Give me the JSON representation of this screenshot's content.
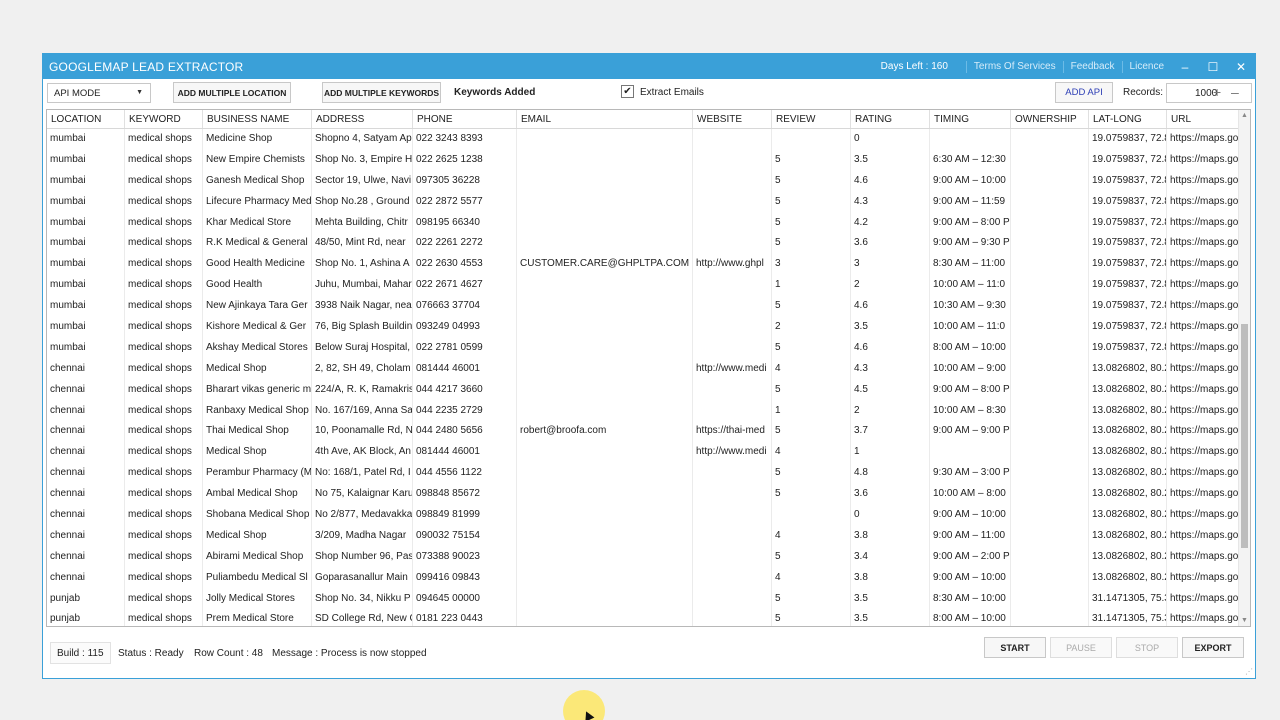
{
  "window": {
    "title": "GOOGLEMAP LEAD EXTRACTOR",
    "days_left": "Days Left : 160",
    "links": [
      "Terms Of Services",
      "Feedback",
      "Licence"
    ],
    "controls": {
      "minimize": "–",
      "maximize": "☐",
      "close": "✕"
    }
  },
  "toolbar": {
    "mode": "API MODE",
    "add_locations": "ADD MULTIPLE LOCATION",
    "add_keywords": "ADD MULTIPLE KEYWORDS",
    "keywords_added": "Keywords Added",
    "extract_emails_label": "Extract Emails",
    "extract_emails_checked": "✔",
    "add_api": "ADD API",
    "records_label": "Records:",
    "records_value": "1000",
    "plus": "+",
    "minus": "–"
  },
  "grid": {
    "columns": [
      "LOCATION",
      "KEYWORD",
      "BUSINESS NAME",
      "ADDRESS",
      "PHONE",
      "EMAIL",
      "WEBSITE",
      "REVIEW",
      "RATING",
      "TIMING",
      "OWNERSHIP",
      "LAT-LONG",
      "URL"
    ],
    "rows": [
      [
        "mumbai",
        "medical shops",
        "Medicine Shop",
        "Shopno 4, Satyam Ap",
        "022 3243 8393",
        "",
        "",
        "",
        "0",
        "",
        "",
        "19.0759837, 72.8",
        "https://maps.goo"
      ],
      [
        "mumbai",
        "medical shops",
        "New Empire Chemists",
        "Shop No. 3, Empire H",
        "022 2625 1238",
        "",
        "",
        "5",
        "3.5",
        "6:30 AM – 12:30",
        "",
        "19.0759837, 72.8",
        "https://maps.goo"
      ],
      [
        "mumbai",
        "medical shops",
        "Ganesh Medical Shop",
        "Sector 19, Ulwe, Navi",
        "097305 36228",
        "",
        "",
        "5",
        "4.6",
        "9:00 AM – 10:00",
        "",
        "19.0759837, 72.8",
        "https://maps.goo"
      ],
      [
        "mumbai",
        "medical shops",
        "Lifecure Pharmacy Med",
        "Shop No.28 , Ground",
        "022 2872 5577",
        "",
        "",
        "5",
        "4.3",
        "9:00 AM – 11:59",
        "",
        "19.0759837, 72.8",
        "https://maps.goo"
      ],
      [
        "mumbai",
        "medical shops",
        "Khar Medical Store",
        "Mehta Building, Chitr",
        "098195 66340",
        "",
        "",
        "5",
        "4.2",
        "9:00 AM – 8:00 P",
        "",
        "19.0759837, 72.8",
        "https://maps.goo"
      ],
      [
        "mumbai",
        "medical shops",
        "R.K Medical & General",
        "48/50, Mint Rd, near",
        "022 2261 2272",
        "",
        "",
        "5",
        "3.6",
        "9:00 AM – 9:30 P",
        "",
        "19.0759837, 72.8",
        "https://maps.goo"
      ],
      [
        "mumbai",
        "medical shops",
        "Good Health Medicine",
        "Shop No. 1, Ashina A",
        "022 2630 4553",
        "CUSTOMER.CARE@GHPLTPA.COM",
        "http://www.ghpl",
        "3",
        "3",
        "8:30 AM – 11:00",
        "",
        "19.0759837, 72.8",
        "https://maps.goo"
      ],
      [
        "mumbai",
        "medical shops",
        "Good Health",
        "Juhu, Mumbai, Mahar",
        "022 2671 4627",
        "",
        "",
        "1",
        "2",
        "10:00 AM – 11:0",
        "",
        "19.0759837, 72.8",
        "https://maps.goo"
      ],
      [
        "mumbai",
        "medical shops",
        "New Ajinkaya Tara Ger",
        "3938 Naik Nagar, nea",
        "076663 37704",
        "",
        "",
        "5",
        "4.6",
        "10:30 AM – 9:30",
        "",
        "19.0759837, 72.8",
        "https://maps.goo"
      ],
      [
        "mumbai",
        "medical shops",
        "Kishore Medical & Ger",
        "76, Big Splash Buildin",
        "093249 04993",
        "",
        "",
        "2",
        "3.5",
        "10:00 AM – 11:0",
        "",
        "19.0759837, 72.8",
        "https://maps.goo"
      ],
      [
        "mumbai",
        "medical shops",
        "Akshay Medical Stores",
        "Below Suraj Hospital,",
        "022 2781 0599",
        "",
        "",
        "5",
        "4.6",
        "8:00 AM – 10:00",
        "",
        "19.0759837, 72.8",
        "https://maps.goo"
      ],
      [
        "chennai",
        "medical shops",
        "Medical Shop",
        "2, 82, SH 49, Cholam",
        "081444 46001",
        "",
        "http://www.medi",
        "4",
        "4.3",
        "10:00 AM – 9:00",
        "",
        "13.0826802, 80.2",
        "https://maps.goo"
      ],
      [
        "chennai",
        "medical shops",
        "Bharart vikas generic m",
        "224/A, R. K, Ramakris",
        "044 4217 3660",
        "",
        "",
        "5",
        "4.5",
        "9:00 AM – 8:00 P",
        "",
        "13.0826802, 80.2",
        "https://maps.goo"
      ],
      [
        "chennai",
        "medical shops",
        "Ranbaxy Medical Shop",
        "No. 167/169, Anna Sa",
        "044 2235 2729",
        "",
        "",
        "1",
        "2",
        "10:00 AM – 8:30",
        "",
        "13.0826802, 80.2",
        "https://maps.goo"
      ],
      [
        "chennai",
        "medical shops",
        "Thai Medical Shop",
        "10, Poonamalle Rd, N",
        "044 2480 5656",
        "robert@broofa.com",
        "https://thai-med",
        "5",
        "3.7",
        "9:00 AM – 9:00 P",
        "",
        "13.0826802, 80.2",
        "https://maps.goo"
      ],
      [
        "chennai",
        "medical shops",
        "Medical Shop",
        "4th Ave, AK Block, An",
        "081444 46001",
        "",
        "http://www.medi",
        "4",
        "1",
        "",
        "",
        "13.0826802, 80.2",
        "https://maps.goo"
      ],
      [
        "chennai",
        "medical shops",
        "Perambur Pharmacy (M",
        "No: 168/1, Patel Rd, I",
        "044 4556 1122",
        "",
        "",
        "5",
        "4.8",
        "9:30 AM – 3:00 P",
        "",
        "13.0826802, 80.2",
        "https://maps.goo"
      ],
      [
        "chennai",
        "medical shops",
        "Ambal Medical Shop",
        "No 75, Kalaignar Karu",
        "098848 85672",
        "",
        "",
        "5",
        "3.6",
        "10:00 AM – 8:00",
        "",
        "13.0826802, 80.2",
        "https://maps.goo"
      ],
      [
        "chennai",
        "medical shops",
        "Shobana Medical Shop",
        "No 2/877, Medavakka",
        "098849 81999",
        "",
        "",
        "",
        "0",
        "9:00 AM – 10:00",
        "",
        "13.0826802, 80.2",
        "https://maps.goo"
      ],
      [
        "chennai",
        "medical shops",
        "Medical Shop",
        "3/209, Madha Nagar",
        "090032 75154",
        "",
        "",
        "4",
        "3.8",
        "9:00 AM – 11:00",
        "",
        "13.0826802, 80.2",
        "https://maps.goo"
      ],
      [
        "chennai",
        "medical shops",
        "Abirami Medical Shop",
        "Shop Number 96, Pas",
        "073388 90023",
        "",
        "",
        "5",
        "3.4",
        "9:00 AM – 2:00 P",
        "",
        "13.0826802, 80.2",
        "https://maps.goo"
      ],
      [
        "chennai",
        "medical shops",
        "Puliambedu Medical Sl",
        "Goparasanallur Main",
        "099416 09843",
        "",
        "",
        "4",
        "3.8",
        "9:00 AM – 10:00",
        "",
        "13.0826802, 80.2",
        "https://maps.goo"
      ],
      [
        "punjab",
        "medical shops",
        "Jolly Medical Stores",
        "Shop No. 34, Nikku P",
        "094645 00000",
        "",
        "",
        "5",
        "3.5",
        "8:30 AM – 10:00",
        "",
        "31.1471305, 75.3",
        "https://maps.goo"
      ],
      [
        "punjab",
        "medical shops",
        "Prem Medical Store",
        "SD College Rd, New C",
        "0181 223 0443",
        "",
        "",
        "5",
        "3.5",
        "8:00 AM – 10:00",
        "",
        "31.1471305, 75.3",
        "https://maps.goo"
      ]
    ]
  },
  "status": {
    "build": "Build : 115",
    "status": "Status : Ready",
    "row_count": "Row Count : 48",
    "message": "Message : Process is now stopped",
    "start": "START",
    "pause": "PAUSE",
    "stop": "STOP",
    "export": "EXPORT"
  }
}
